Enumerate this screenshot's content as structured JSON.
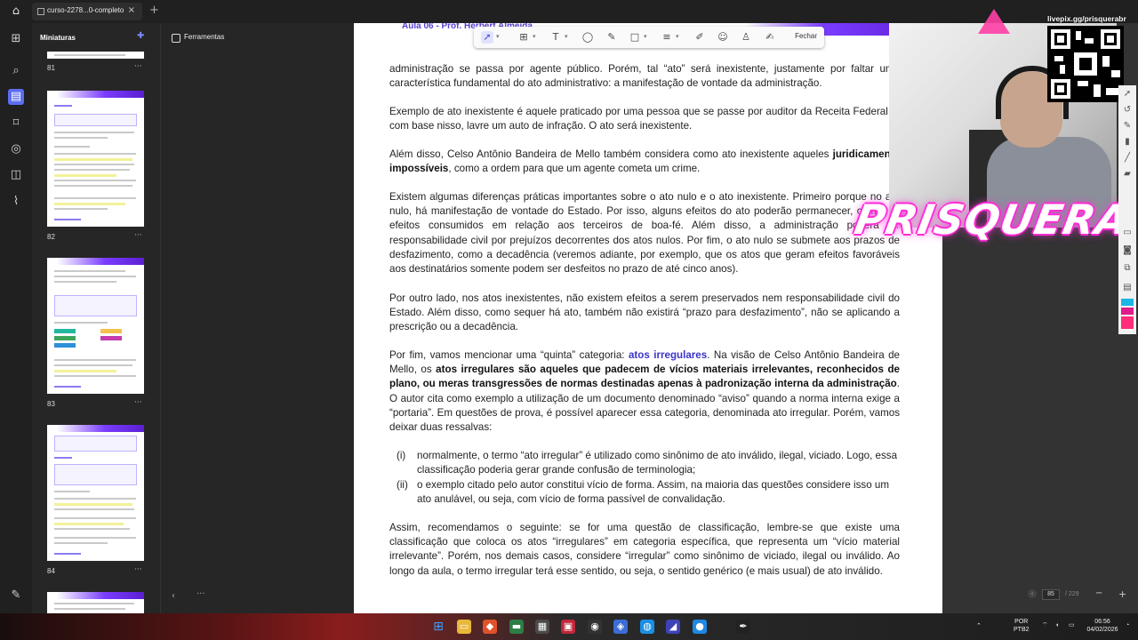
{
  "titlebar": {
    "tab_title": "curso-2278...0-completo",
    "tab_close": "×",
    "new_tab": "+"
  },
  "thumbnails_panel": {
    "title": "Miniaturas",
    "pages": [
      {
        "number": "81"
      },
      {
        "number": "82"
      },
      {
        "number": "83"
      },
      {
        "number": "84"
      }
    ],
    "more": "···"
  },
  "tools_panel": {
    "label": "Ferramentas",
    "scroll_prev": "‹",
    "scroll_more": "···"
  },
  "edit_toolbar": {
    "close_label": "Fechar"
  },
  "document": {
    "header": "Aula 06 - Prof. Herbert Almeida",
    "p1": "administração se passa por agente público. Porém, tal “ato” será inexistente, justamente por faltar uma característica fundamental do ato administrativo: a manifestação de vontade da administração.",
    "p2": "Exemplo de ato inexistente é aquele praticado por uma pessoa que se passe por auditor da Receita Federal e, com base nisso, lavre um auto de infração. O ato será inexistente.",
    "p3_a": "Além disso, Celso Antônio Bandeira de Mello também considera como ato inexistente aqueles ",
    "p3_b": "juridicamente impossíveis",
    "p3_c": ", como a ordem para que um agente cometa um crime.",
    "p4": "Existem algumas diferenças práticas importantes sobre o ato nulo e o ato inexistente. Primeiro porque no ato nulo, há manifestação de vontade do Estado. Por isso, alguns efeitos do ato poderão permanecer, como, os efeitos consumidos em relação aos terceiros de boa-fé. Além disso, a administração poderá ter responsabilidade civil por prejuízos decorrentes dos atos nulos. Por fim, o ato nulo se submete aos prazos de desfazimento, como a decadência (veremos adiante, por exemplo, que os atos que geram efeitos favoráveis aos destinatários somente podem ser desfeitos no prazo de até cinco anos).",
    "p5": "Por outro lado, nos atos inexistentes, não existem efeitos a serem preservados nem responsabilidade civil do Estado. Além disso, como sequer há ato, também não existirá “prazo para desfazimento”, não se aplicando a prescrição ou a decadência.",
    "p6_a": "Por fim, vamos mencionar uma “quinta” categoria: ",
    "p6_link": "atos irregulares",
    "p6_b": ". Na visão de Celso Antônio Bandeira de Mello, os ",
    "p6_bold": "atos irregulares são aqueles que padecem de vícios materiais irrelevantes, reconhecidos de plano, ou meras transgressões de normas destinadas apenas à padronização interna da administração",
    "p6_c": ". O autor cita como exemplo a utilização de um documento denominado “aviso” quando a norma interna exige a “portaria”. Em questões de prova, é possível aparecer essa categoria, denominada ato irregular. Porém, vamos deixar duas ressalvas:",
    "items": [
      {
        "marker": "(i)",
        "text": "normalmente, o termo “ato irregular” é utilizado como sinônimo de ato inválido, ilegal, viciado. Logo, essa classificação poderia gerar grande confusão de terminologia;"
      },
      {
        "marker": "(ii)",
        "text": "o exemplo citado pelo autor constitui vício de forma. Assim, na maioria das questões considere isso um ato anulável, ou seja, com vício de forma passível de convalidação."
      }
    ],
    "p7": "Assim, recomendamos o seguinte: se for uma questão de classificação, lembre-se que existe uma classificação que coloca os atos “irregulares” em categoria específica, que representa um “vício material irrelevante”. Porém, nos demais casos, considere “irregular” como sinônimo de viciado, ilegal ou inválido. Ao longo da aula, o termo irregular terá esse sentido, ou seja, o sentido genérico (e mais usual) de ato inválido."
  },
  "page_nav": {
    "current_page": "85",
    "total_pages": "/ 229",
    "zoom_out": "−",
    "zoom_in": "+"
  },
  "overlay": {
    "qr_label": "livepix.gg/prisquerabr",
    "brand": "PRISQUERA"
  },
  "taskbar": {
    "lang_top": "POR",
    "lang_bottom": "PTB2",
    "time": "06:56",
    "date": "04/02/2026"
  },
  "colors": {
    "accent": "#5b6df0",
    "link": "#3a34c9",
    "brand_glow": "#ff2bd6",
    "header_purple": "#5a3fd0"
  }
}
